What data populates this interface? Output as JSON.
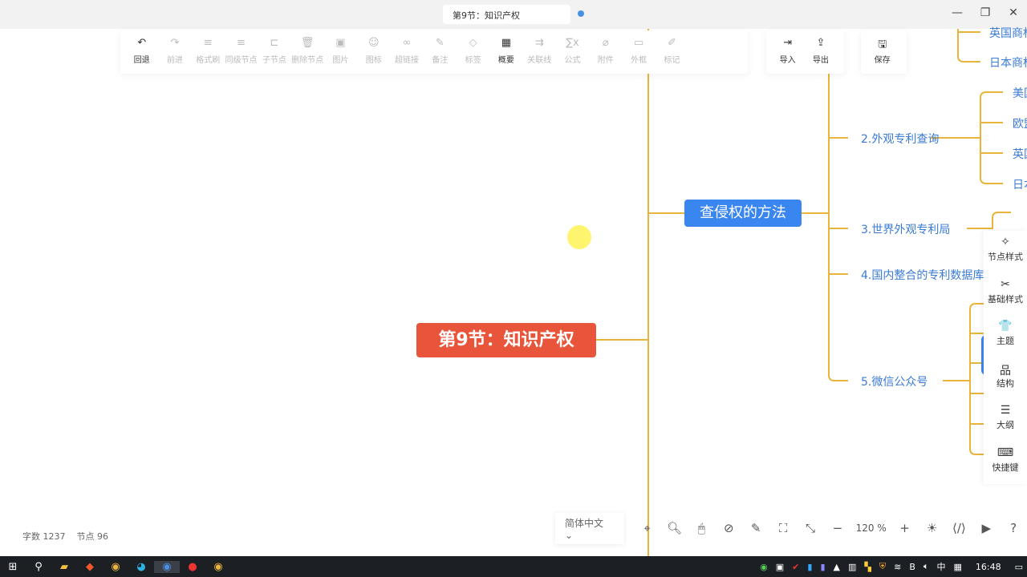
{
  "window": {
    "tab_title": "第9节：知识产权",
    "minimize": "—",
    "restore": "❐",
    "close": "✕"
  },
  "toolbar": {
    "items": [
      {
        "label": "回退",
        "icon": "undo-icon",
        "glyph": "↶",
        "enabled": true
      },
      {
        "label": "前进",
        "icon": "redo-icon",
        "glyph": "↷",
        "enabled": false
      },
      {
        "label": "格式刷",
        "icon": "format-painter-icon",
        "glyph": "≡",
        "enabled": false
      },
      {
        "label": "同级节点",
        "icon": "sibling-node-icon",
        "glyph": "≡",
        "enabled": false
      },
      {
        "label": "子节点",
        "icon": "child-node-icon",
        "glyph": "⊏",
        "enabled": false
      },
      {
        "label": "删除节点",
        "icon": "trash-icon",
        "glyph": "🗑",
        "enabled": false
      },
      {
        "label": "图片",
        "icon": "image-icon",
        "glyph": "▣",
        "enabled": false
      },
      {
        "label": "图标",
        "icon": "smiley-icon",
        "glyph": "☺",
        "enabled": false
      },
      {
        "label": "超链接",
        "icon": "link-icon",
        "glyph": "∞",
        "enabled": false
      },
      {
        "label": "备注",
        "icon": "note-icon",
        "glyph": "✎",
        "enabled": false
      },
      {
        "label": "标签",
        "icon": "tag-icon",
        "glyph": "◇",
        "enabled": false
      },
      {
        "label": "概要",
        "icon": "summary-icon",
        "glyph": "▦",
        "enabled": true
      },
      {
        "label": "关联线",
        "icon": "relation-line-icon",
        "glyph": "⇉",
        "enabled": false
      },
      {
        "label": "公式",
        "icon": "formula-icon",
        "glyph": "∑x",
        "enabled": false
      },
      {
        "label": "附件",
        "icon": "attachment-icon",
        "glyph": "⌀",
        "enabled": false
      },
      {
        "label": "外框",
        "icon": "frame-icon",
        "glyph": "▭",
        "enabled": false
      },
      {
        "label": "标记",
        "icon": "marker-icon",
        "glyph": "✐",
        "enabled": false
      }
    ],
    "io": [
      {
        "label": "导入",
        "icon": "import-icon",
        "glyph": "⇥"
      },
      {
        "label": "导出",
        "icon": "export-icon",
        "glyph": "⇪"
      }
    ],
    "save": {
      "label": "保存",
      "icon": "save-icon",
      "glyph": "🖫"
    }
  },
  "mindmap": {
    "root": "第9节：知识产权",
    "main": "查侵权的方法",
    "children": [
      "2.外观专利查询",
      "3.世界外观专利局",
      "4.国内整合的专利数据库",
      "5.微信公众号"
    ],
    "top_leaves": [
      "英国商标",
      "日本商标"
    ],
    "sub_leaves": [
      "美国",
      "欧盟",
      "英国",
      "日本"
    ]
  },
  "right_panel": [
    {
      "label": "节点样式",
      "glyph": "✧"
    },
    {
      "label": "基础样式",
      "glyph": "✂"
    },
    {
      "label": "主题",
      "glyph": "👕"
    },
    {
      "label": "结构",
      "glyph": "品"
    },
    {
      "label": "大纲",
      "glyph": "☰"
    },
    {
      "label": "快捷键",
      "glyph": "⌨"
    }
  ],
  "status": {
    "words_label": "字数",
    "words": "1237",
    "nodes_label": "节点",
    "nodes": "96"
  },
  "bottom": {
    "language": "简体中文",
    "zoom": "120",
    "zoom_unit": "%"
  },
  "taskbar": {
    "time": "16:48",
    "ime": "中"
  }
}
